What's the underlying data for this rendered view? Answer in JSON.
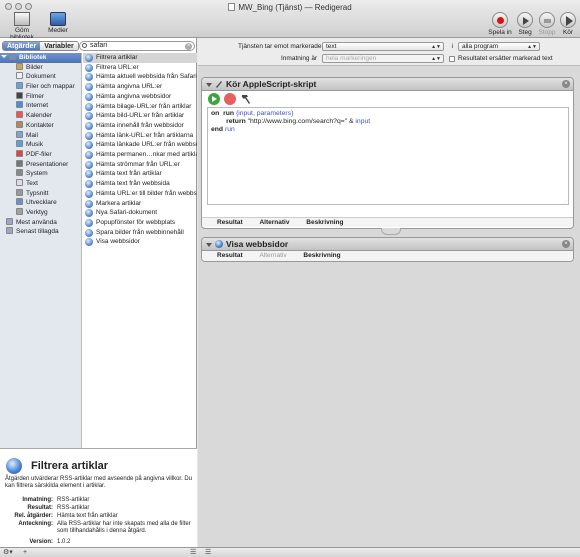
{
  "window": {
    "title": "MW_Bing (Tjänst) — Redigerad"
  },
  "toolbar": {
    "left_buttons": [
      "Göm bibliotek",
      "Medier"
    ],
    "right_buttons": [
      "Spela in",
      "Steg",
      "Stopp",
      "Kör"
    ]
  },
  "library": {
    "segments": [
      "Åtgärder",
      "Variabler"
    ],
    "search_value": "safari",
    "categories": [
      {
        "label": "Bibliotek",
        "icon": "library-folder-icon",
        "color": "#6a8fcf"
      },
      {
        "label": "Bilder",
        "icon": "photos-icon",
        "color": "#c9a45a"
      },
      {
        "label": "Dokument",
        "icon": "document-icon",
        "color": "#f0f0f0"
      },
      {
        "label": "Filer och mappar",
        "icon": "finder-icon",
        "color": "#6aa1df"
      },
      {
        "label": "Filmer",
        "icon": "movie-icon",
        "color": "#444"
      },
      {
        "label": "Internet",
        "icon": "globe-icon",
        "color": "#4a8de0"
      },
      {
        "label": "Kalender",
        "icon": "calendar-icon",
        "color": "#e55"
      },
      {
        "label": "Kontakter",
        "icon": "contacts-icon",
        "color": "#b08a5a"
      },
      {
        "label": "Mail",
        "icon": "mail-icon",
        "color": "#7aa6d8"
      },
      {
        "label": "Musik",
        "icon": "music-icon",
        "color": "#5e9fd9"
      },
      {
        "label": "PDF-filer",
        "icon": "pdf-icon",
        "color": "#d44"
      },
      {
        "label": "Presentationer",
        "icon": "presentation-icon",
        "color": "#777"
      },
      {
        "label": "System",
        "icon": "system-icon",
        "color": "#888"
      },
      {
        "label": "Text",
        "icon": "text-icon",
        "color": "#ddd"
      },
      {
        "label": "Typsnitt",
        "icon": "fonts-icon",
        "color": "#999"
      },
      {
        "label": "Utvecklare",
        "icon": "developer-icon",
        "color": "#6b8fc7"
      },
      {
        "label": "Verktyg",
        "icon": "utilities-icon",
        "color": "#a0a0a0"
      },
      {
        "label": "Mest använda",
        "icon": "smart-folder-icon",
        "color": "#9aa7c7"
      },
      {
        "label": "Senast tillagda",
        "icon": "smart-folder-icon",
        "color": "#9aa7c7"
      }
    ],
    "actions": [
      "Filtrera artiklar",
      "Filtrera URL:er",
      "Hämta aktuell webbsida från Safari",
      "Hämta angivna URL:er",
      "Hämta angivna webbsidor",
      "Hämta bilage-URL:er från artiklar",
      "Hämta bild-URL:er från artiklar",
      "Hämta innehåll från webbsidor",
      "Hämta länk-URL:er från artiklarna",
      "Hämta länkade URL:er från webbsidor",
      "Hämta permanen…nkar med artiklar",
      "Hämta strömmar från URL:er",
      "Hämta text från artiklar",
      "Hämta text från webbsida",
      "Hämta URL:er till bilder från webbsida",
      "Markera artiklar",
      "Nya Safari-dokument",
      "Popupfönster för webbplats",
      "Spara bilder från webbinnehåll",
      "Visa webbsidor"
    ]
  },
  "description": {
    "title": "Filtrera artiklar",
    "lead": "Åtgärden utvärderar RSS-artiklar med avseende på angivna villkor. Du kan filtrera särskilda element i artiklar.",
    "rows": [
      {
        "key": "Inmatning:",
        "value": "RSS-artiklar"
      },
      {
        "key": "Resultat:",
        "value": "RSS-artiklar"
      },
      {
        "key": "Rel. åtgärder:",
        "value": "Hämta text från artiklar"
      },
      {
        "key": "Anteckning:",
        "value": "Alla RSS-artiklar har inte skapats med alla de filter som tillhandahålls i denna åtgärd."
      },
      {
        "key": "Version:",
        "value": "1.0.2"
      }
    ]
  },
  "service": {
    "receives_label": "Tjänsten tar emot markerade",
    "receives_value": "text",
    "in_label": "i",
    "in_value": "alla program",
    "input_is_label": "Inmatning är",
    "input_is_value": "hela markeringen",
    "replaces_label": "Resultatet ersätter markerad text"
  },
  "actions_in_workflow": [
    {
      "title": "Kör AppleScript-skript",
      "code_lines": [
        {
          "parts": [
            [
              "kw",
              "on"
            ],
            [
              "",
              "  "
            ],
            [
              "kw",
              "run"
            ],
            [
              "",
              " "
            ],
            [
              "var",
              "{input, parameters}"
            ]
          ]
        },
        {
          "parts": [
            [
              "",
              "        "
            ],
            [
              "kw",
              "return"
            ],
            [
              "",
              " \"http://www.bing.com/search?q=\" & "
            ],
            [
              "var",
              "input"
            ]
          ]
        },
        {
          "parts": [
            [
              "kw",
              "end"
            ],
            [
              "",
              " "
            ],
            [
              "var",
              "run"
            ]
          ]
        }
      ],
      "tabs": [
        "Resultat",
        "Alternativ",
        "Beskrivning"
      ]
    },
    {
      "title": "Visa webbsidor",
      "tabs": [
        "Resultat",
        "Alternativ",
        "Beskrivning"
      ]
    }
  ]
}
